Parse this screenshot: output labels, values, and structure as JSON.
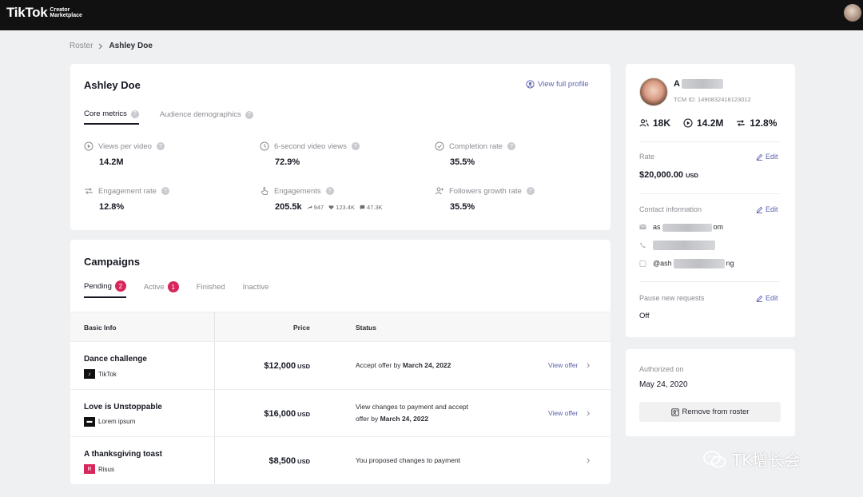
{
  "header": {
    "logo": "TikTok",
    "logo_sub_line1": "Creator",
    "logo_sub_line2": "Marketplace"
  },
  "breadcrumb": {
    "parent": "Roster",
    "current": "Ashley Doe"
  },
  "profile": {
    "name": "Ashley Doe",
    "view_full_profile": "View full profile",
    "tabs": [
      {
        "label": "Core metrics",
        "active": true
      },
      {
        "label": "Audience demographics",
        "active": false
      }
    ],
    "metrics": [
      {
        "label": "Views per video",
        "value": "14.2M",
        "icon": "play-circle-icon"
      },
      {
        "label": "6-second video views",
        "value": "72.9%",
        "icon": "clock-icon"
      },
      {
        "label": "Completion rate",
        "value": "35.5%",
        "icon": "check-circle-icon"
      },
      {
        "label": "Engagement rate",
        "value": "12.8%",
        "icon": "repeat-icon"
      },
      {
        "label": "Engagements",
        "value": "205.5k",
        "icon": "hand-pointer-icon",
        "breakdown": {
          "shares": "947",
          "likes": "123.4K",
          "comments": "47.3K"
        }
      },
      {
        "label": "Followers growth rate",
        "value": "35.5%",
        "icon": "user-plus-icon"
      }
    ]
  },
  "campaigns": {
    "title": "Campaigns",
    "tabs": [
      {
        "label": "Pending",
        "count": "2",
        "active": true
      },
      {
        "label": "Active",
        "count": "1",
        "active": false
      },
      {
        "label": "Finished",
        "count": "",
        "active": false
      },
      {
        "label": "Inactive",
        "count": "",
        "active": false
      }
    ],
    "columns": {
      "basic_info": "Basic Info",
      "price": "Price",
      "status": "Status"
    },
    "rows": [
      {
        "title": "Dance challenge",
        "brand": "TikTok",
        "brand_mark": "♪",
        "price": "$12,000",
        "currency": "USD",
        "status_line1": "Accept offer by ",
        "status_bold1": "March 24, 2022",
        "status_line2": "",
        "status_bold2": "",
        "action": "View offer"
      },
      {
        "title": "Love is Unstoppable",
        "brand": "Lorem ipsum",
        "brand_mark": "▬",
        "price": "$16,000",
        "currency": "USD",
        "status_line1": "View changes to payment and accept",
        "status_bold1": "",
        "status_line2": "offer by ",
        "status_bold2": "March 24, 2022",
        "action": "View offer"
      },
      {
        "title": "A thanksgiving toast",
        "brand": "Risus",
        "brand_mark": "R",
        "price": "$8,500",
        "currency": "USD",
        "status_line1": "You proposed changes to payment",
        "status_bold1": "",
        "status_line2": "",
        "status_bold2": "",
        "action": ""
      }
    ]
  },
  "creator": {
    "name_prefix": "A",
    "tcm_id": "TCM ID: 1490832418123012",
    "followers": "18K",
    "views": "14.2M",
    "engagement": "12.8%",
    "rate_label": "Rate",
    "rate_value": "$20,000.00",
    "rate_currency": "USD",
    "edit_label": "Edit",
    "contact_label": "Contact information",
    "email_prefix": "as",
    "email_suffix": "om",
    "social_prefix": "@ash",
    "social_suffix": "ng",
    "pause_label": "Pause new requests",
    "pause_value": "Off"
  },
  "authorization": {
    "label": "Authorized on",
    "date": "May 24, 2020",
    "remove_button": "Remove from roster"
  },
  "watermark": "TK增长会",
  "colors": {
    "accent": "#5b63b0",
    "badge": "#d7265b",
    "topbar": "#111111"
  }
}
